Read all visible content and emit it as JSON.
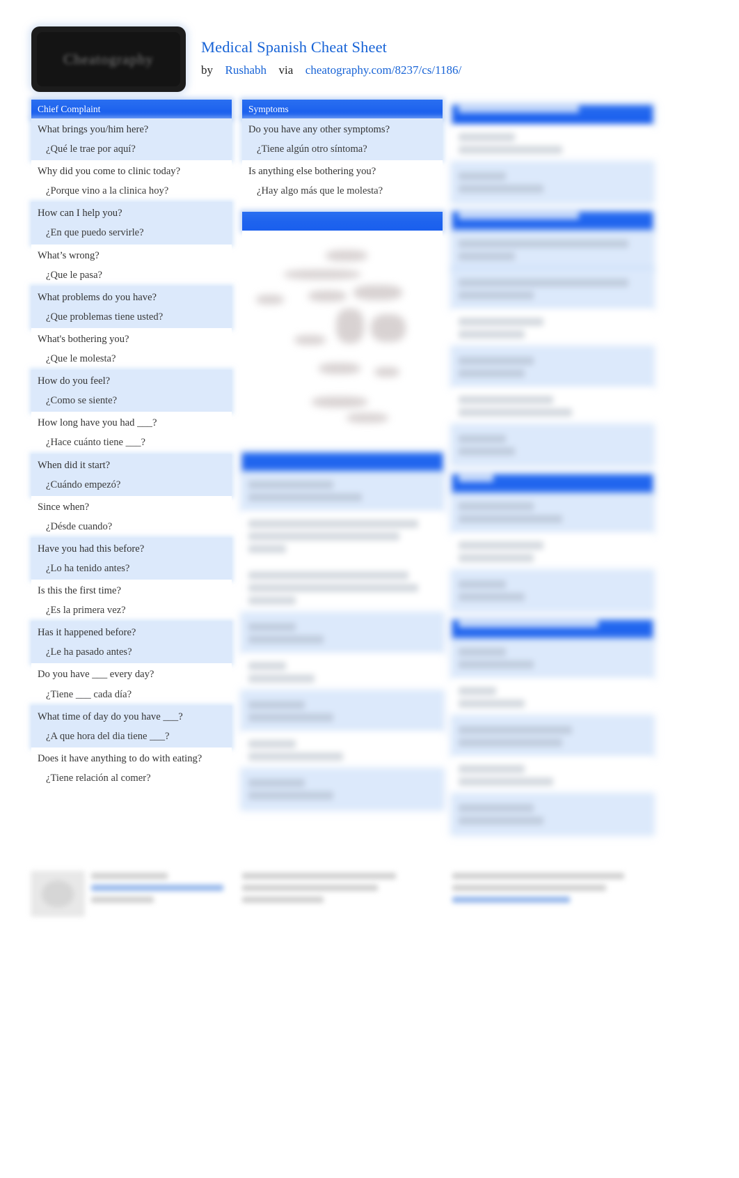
{
  "header": {
    "logo_text": "Cheatography",
    "title": "Medical Spanish Cheat Sheet",
    "by_label": "by",
    "author": "Rushabh",
    "via_label": "via",
    "source_url": "cheatography.com/8237/cs/1186/"
  },
  "columns": [
    {
      "id": "column-1",
      "blocks": [
        {
          "id": "chief-complaint",
          "heading": "Chief Complaint",
          "legible": true,
          "rows": [
            {
              "en": "What brings you/him here?",
              "es": "¿Qué le trae por aquí?"
            },
            {
              "en": "Why did you come to clinic today?",
              "es": "¿Porque vino a la clinica hoy?"
            },
            {
              "en": "How can I help you?",
              "es": "¿En que puedo servirle?"
            },
            {
              "en": "What’s wrong?",
              "es": "¿Que le pasa?"
            },
            {
              "en": "What problems do you have?",
              "es": "¿Que problemas tiene usted?"
            },
            {
              "en": "What's bothering you?",
              "es": "¿Que le molesta?"
            },
            {
              "en": "How do you feel?",
              "es": "¿Como se siente?"
            },
            {
              "en": "How long have you had ___?",
              "es": "¿Hace cuánto tiene ___?"
            },
            {
              "en": "When did it start?",
              "es": "¿Cuándo empezó?"
            },
            {
              "en": "Since when?",
              "es": "¿Désde cuando?"
            },
            {
              "en": "Have you had this before?",
              "es": "¿Lo ha tenido antes?"
            },
            {
              "en": "Is this the first time?",
              "es": "¿Es la primera vez?"
            },
            {
              "en": "Has it happened before?",
              "es": "¿Le ha pasado antes?"
            },
            {
              "en": "Do you have ___ every day?",
              "es": "¿Tiene ___ cada día?"
            },
            {
              "en": "What time of day do you have ___?",
              "es": "¿A que hora del dia tiene ___?"
            },
            {
              "en": "Does it have anything to do with eating?",
              "es": "¿Tiene relación al comer?"
            }
          ]
        }
      ]
    },
    {
      "id": "column-2",
      "blocks": [
        {
          "id": "symptoms",
          "heading": "Symptoms",
          "legible": true,
          "rows": [
            {
              "en": "Do you have any other symptoms?",
              "es": "¿Tiene algún otro síntoma?"
            },
            {
              "en": "Is anything else bothering you?",
              "es": "¿Hay algo más que le molesta?"
            }
          ]
        },
        {
          "id": "col2-block-2",
          "heading": "",
          "legible": false,
          "kind": "image"
        },
        {
          "id": "col2-block-3",
          "heading": "",
          "legible": false,
          "kind": "rows"
        }
      ]
    },
    {
      "id": "column-3",
      "blocks": [
        {
          "id": "col3-block-1",
          "heading": "",
          "legible": false,
          "kind": "rows"
        },
        {
          "id": "col3-block-2",
          "heading": "",
          "legible": false,
          "kind": "rows"
        },
        {
          "id": "col3-block-3",
          "heading": "",
          "legible": false,
          "kind": "rows"
        },
        {
          "id": "col3-block-4",
          "heading": "",
          "legible": false,
          "kind": "rows"
        }
      ]
    }
  ],
  "footer": {
    "legible": false,
    "columns": [
      {
        "id": "footer-author",
        "has_thumbnail": true
      },
      {
        "id": "footer-published"
      },
      {
        "id": "footer-sponsor"
      }
    ]
  },
  "theme": {
    "header_blue": "#1e63ee",
    "link_blue": "#1763d6",
    "row_alt": "#dce9fb",
    "text": "#333333"
  }
}
